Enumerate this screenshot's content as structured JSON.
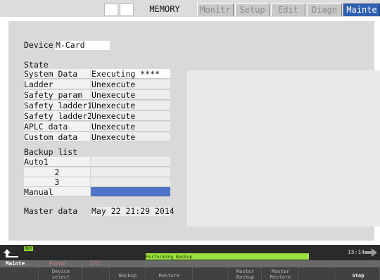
{
  "top_tabs": {
    "memory": "MEMORY",
    "monitor": "Monitr",
    "setup": "Setup",
    "edit": "Edit",
    "diagn": "Diagn",
    "mainte": "Mainte"
  },
  "device": {
    "label": "Device",
    "value": "M-Card"
  },
  "state": {
    "heading": "State",
    "rows": [
      {
        "label": "System Data",
        "value": "Executing ****"
      },
      {
        "label": "Ladder",
        "value": "Unexecute"
      },
      {
        "label": "Safety param",
        "value": "Unexecute"
      },
      {
        "label": "Safety ladder1",
        "value": "Unexecute"
      },
      {
        "label": "Safety ladder2",
        "value": "Unexecute"
      },
      {
        "label": "APLC data",
        "value": "Unexecute"
      },
      {
        "label": "Custom data",
        "value": "Unexecute"
      }
    ]
  },
  "backup_list": {
    "heading": "Backup list",
    "rows": [
      {
        "label": "Auto1",
        "value": ""
      },
      {
        "label": "2",
        "value": ""
      },
      {
        "label": "3",
        "value": ""
      },
      {
        "label": "Manual",
        "value": ""
      }
    ]
  },
  "master_data": {
    "label": "Master data",
    "value": "May 22 21:29 2014"
  },
  "status_bar": {
    "rdy": "RDY",
    "progress_text": "Performing Backup",
    "progress_fraction": 0.9,
    "clock": "15:14"
  },
  "nav": {
    "mainte": "Mainte",
    "param": "Param",
    "io": "I/O"
  },
  "function_keys": {
    "device_select": "Device\nselect",
    "backup": "Backup",
    "restore": "Restore",
    "master_backup": "Master\nBackup",
    "master_restore": "Master\nRestore",
    "stop": "Stop"
  },
  "colors": {
    "active_tab": "#2f5fb0",
    "selected_row": "#4f73c8",
    "progress": "#9ae23c",
    "rdy": "#8fd62e"
  }
}
